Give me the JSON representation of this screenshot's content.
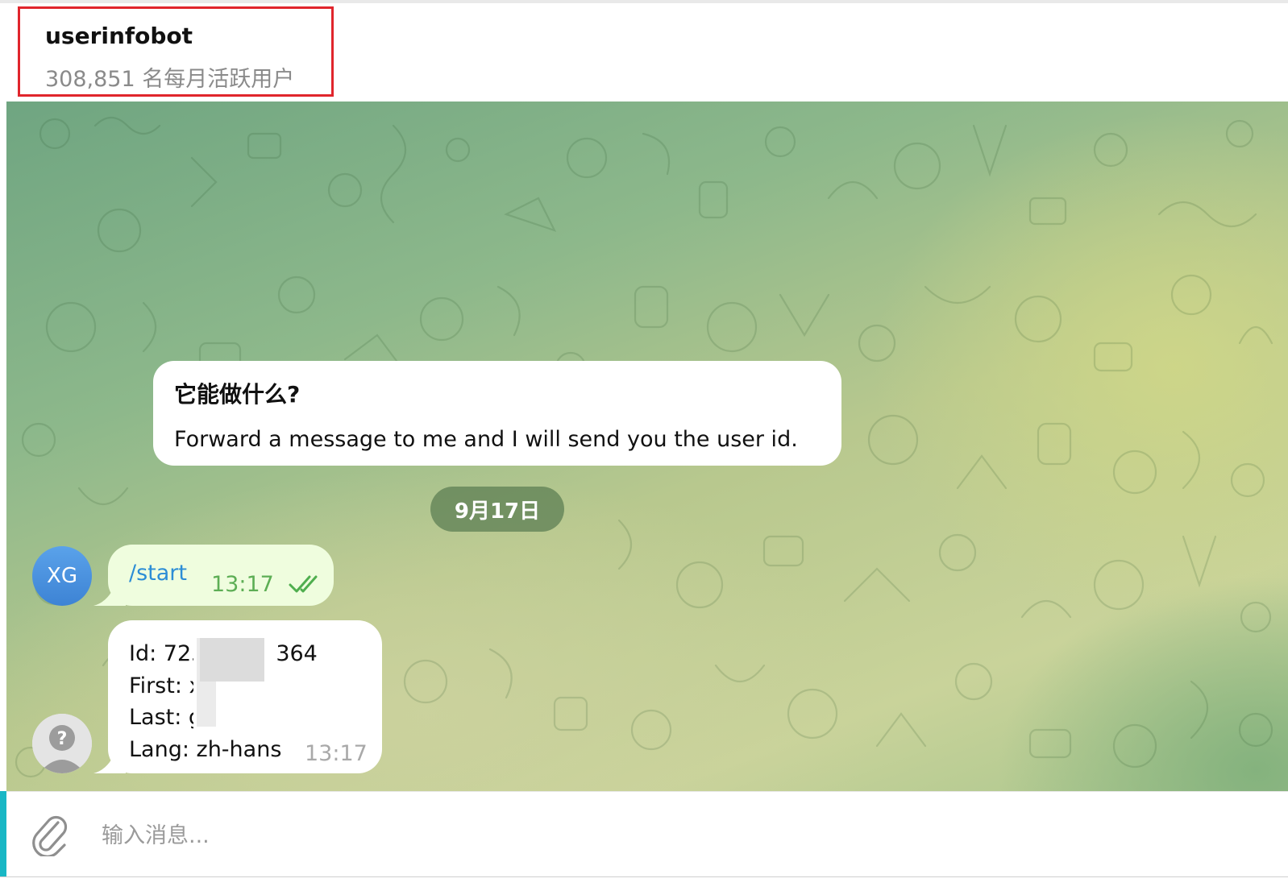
{
  "header": {
    "title": "userinfobot",
    "subtitle": "308,851 名每月活跃用户"
  },
  "intro_card": {
    "title": "它能做什么?",
    "text": "Forward a message to me and I will send you the user id."
  },
  "date_divider": "9月17日",
  "messages": [
    {
      "direction": "outgoing",
      "avatar_initials": "XG",
      "text": "/start",
      "time": "13:17",
      "status_icon": "double-check-icon"
    },
    {
      "direction": "incoming",
      "avatar_icon": "question-avatar-icon",
      "lines": [
        "Id: 725",
        "First: x",
        "Last: g",
        "Lang: zh-hans"
      ],
      "lines_tail": [
        "364",
        "",
        "",
        ""
      ],
      "time": "13:17"
    }
  ],
  "composer": {
    "placeholder": "输入消息...",
    "attach_icon": "paperclip-icon"
  },
  "colors": {
    "highlight_box": "#e0252c",
    "link_text": "#2c8dd6",
    "outgoing_time": "#5dae55",
    "outgoing_bubble": "#effdde",
    "avatar_xg": "#4a93e0"
  }
}
